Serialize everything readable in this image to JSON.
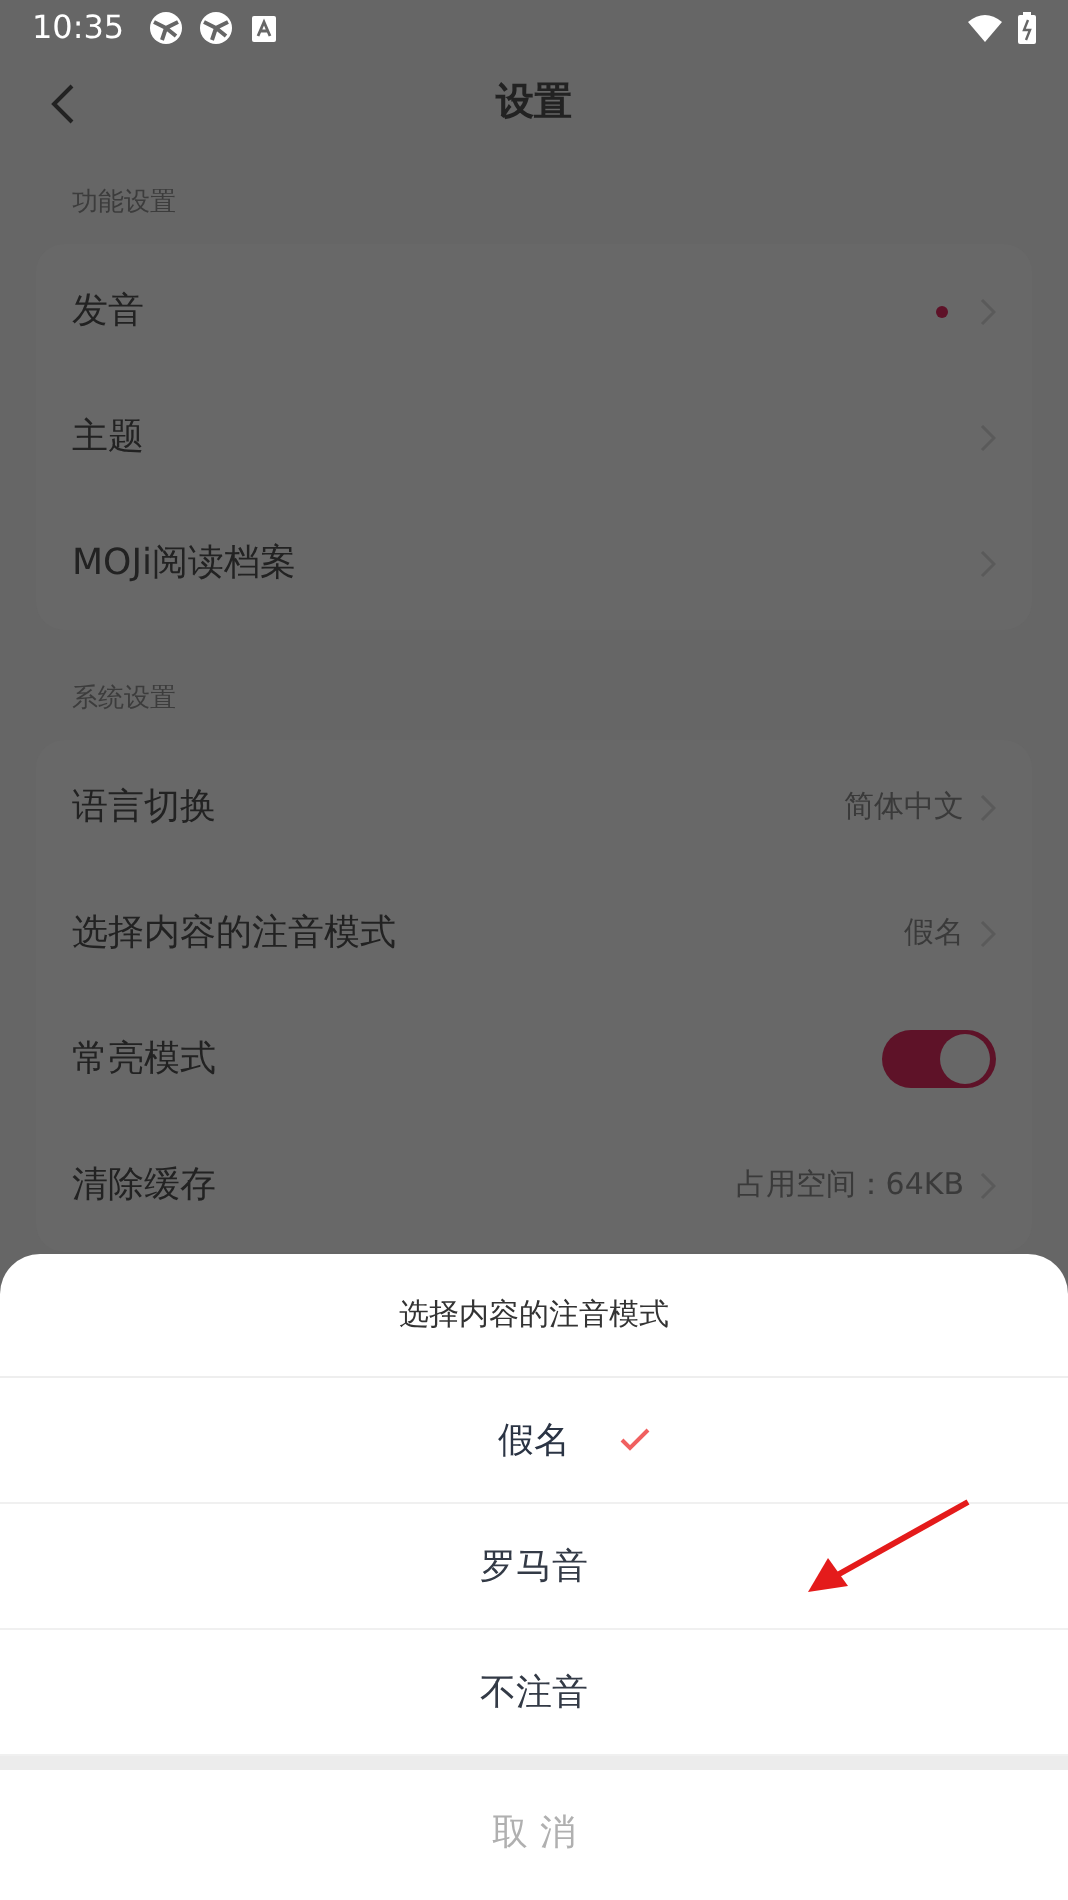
{
  "status_bar": {
    "time": "10:35"
  },
  "header": {
    "title": "设置"
  },
  "sections": [
    {
      "title": "功能设置",
      "rows": [
        {
          "kind": "link",
          "label": "发音",
          "badge": true
        },
        {
          "kind": "link",
          "label": "主题",
          "badge": false
        },
        {
          "kind": "link",
          "label": "MOJi阅读档案",
          "badge": false
        }
      ]
    },
    {
      "title": "系统设置",
      "rows": [
        {
          "kind": "link",
          "label": "语言切换",
          "value": "简体中文",
          "badge": false
        },
        {
          "kind": "link",
          "label": "选择内容的注音模式",
          "value": "假名",
          "badge": false
        },
        {
          "kind": "switch",
          "label": "常亮模式",
          "on": true
        },
        {
          "kind": "link",
          "label": "清除缓存",
          "value": "占用空间：64KB",
          "badge": false
        }
      ]
    }
  ],
  "sheet": {
    "title": "选择内容的注音模式",
    "options": [
      {
        "label": "假名",
        "selected": true
      },
      {
        "label": "罗马音",
        "selected": false
      },
      {
        "label": "不注音",
        "selected": false
      }
    ],
    "cancel": "取 消"
  }
}
